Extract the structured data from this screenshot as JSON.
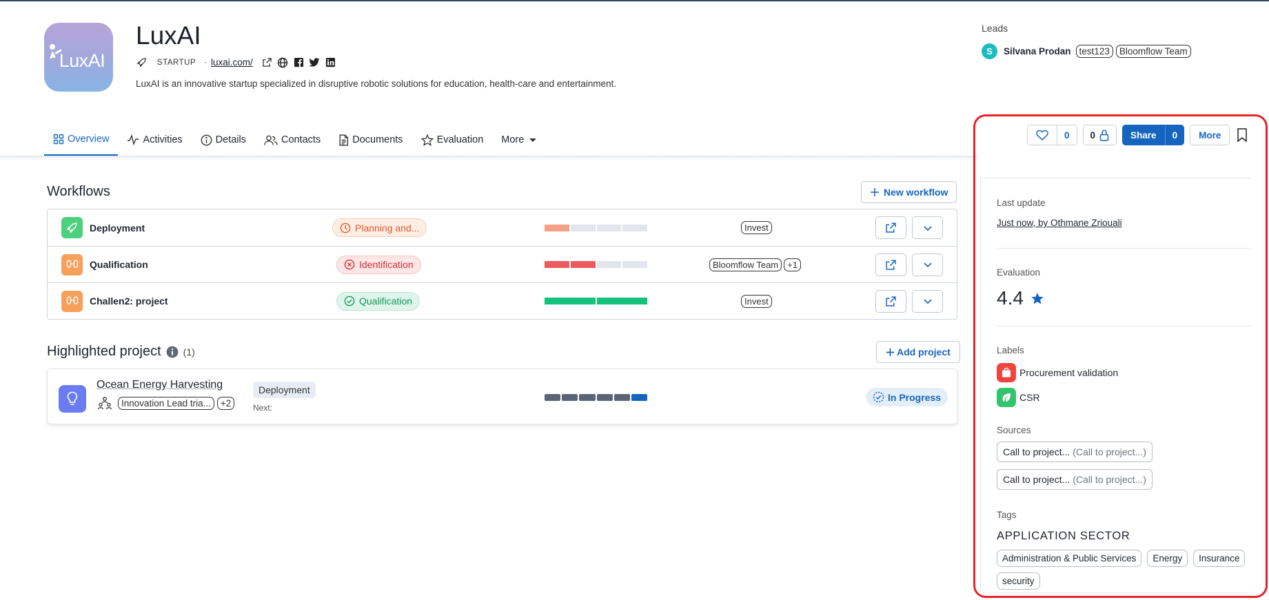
{
  "company": {
    "name": "LuxAI",
    "logo_text": "LuxAI",
    "type": "STARTUP",
    "separator": "·",
    "website": "luxai.com/",
    "description": "LuxAI is an innovative startup specialized in disruptive robotic solutions for education, health-care and entertainment."
  },
  "leads": {
    "label": "Leads",
    "avatar_letter": "S",
    "name": "Silvana Prodan",
    "chips": [
      "test123",
      "Bloomflow Team"
    ]
  },
  "tabs": [
    {
      "label": "Overview",
      "icon": "grid-icon",
      "active": true
    },
    {
      "label": "Activities",
      "icon": "activity-icon"
    },
    {
      "label": "Details",
      "icon": "info-icon"
    },
    {
      "label": "Contacts",
      "icon": "contacts-icon"
    },
    {
      "label": "Documents",
      "icon": "document-icon"
    },
    {
      "label": "Evaluation",
      "icon": "star-icon"
    },
    {
      "label": "More",
      "icon": "caret-down-icon"
    }
  ],
  "actions": {
    "likes": "0",
    "private_count": "0",
    "share_label": "Share",
    "share_count": "0",
    "more_label": "More"
  },
  "workflows": {
    "title": "Workflows",
    "new_button": "New workflow",
    "rows": [
      {
        "name": "Deployment",
        "status": "Planning and...",
        "status_kind": "planning",
        "progress_filled": 1,
        "progress_total": 4,
        "progress_color": "#f4a186",
        "chips": [
          "Invest"
        ]
      },
      {
        "name": "Qualification",
        "status": "Identification",
        "status_kind": "identification",
        "progress_filled": 2,
        "progress_total": 4,
        "progress_color": "#ef5a5f",
        "chips": [
          "Bloomflow Team",
          "+1"
        ]
      },
      {
        "name": "Challen2: project",
        "status": "Qualification",
        "status_kind": "qualification",
        "progress_filled": 2,
        "progress_total": 2,
        "progress_color": "#15c27a",
        "chips": [
          "Invest"
        ]
      }
    ]
  },
  "highlighted": {
    "title": "Highlighted project",
    "count": "(1)",
    "add_button": "Add project",
    "project": {
      "name": "Ocean Energy Harvesting",
      "owner_chip": "Innovation Lead tria...",
      "extra_chip": "+2",
      "stage": "Deployment",
      "next_label": "Next:",
      "progress_filled": 6,
      "progress_total": 6,
      "status": "In Progress"
    }
  },
  "panel": {
    "last_update_label": "Last update",
    "last_update_value": "Just now, by Othmane Zriouali",
    "evaluation_label": "Evaluation",
    "evaluation_score": "4.4",
    "labels_label": "Labels",
    "labels": [
      {
        "text": "Procurement validation",
        "color": "#f0443e",
        "icon": "bag-icon"
      },
      {
        "text": "CSR",
        "color": "#33c46e",
        "icon": "leaf-icon"
      }
    ],
    "sources_label": "Sources",
    "sources": [
      {
        "text": "Call to project...",
        "muted": "(Call to project...)"
      },
      {
        "text": "Call to project...",
        "muted": "(Call to project...)"
      }
    ],
    "tags_label": "Tags",
    "tag_group": "APPLICATION SECTOR",
    "tags": [
      "Administration & Public Services",
      "Energy",
      "Insurance",
      "security"
    ]
  },
  "colors": {
    "accent": "#1565c0",
    "highlight_border": "#e8212b"
  }
}
